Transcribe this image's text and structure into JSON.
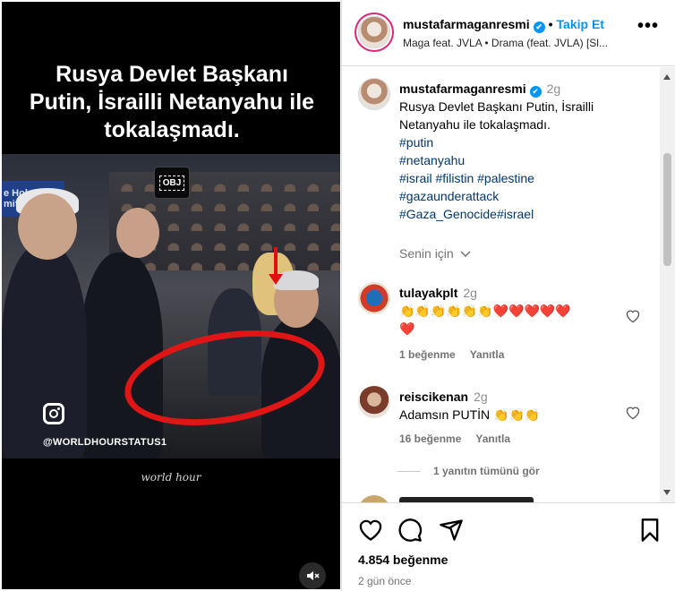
{
  "video": {
    "headline_lines": [
      "Rusya Devlet Başkanı",
      "Putin, İsrailli Netanyahu ile",
      "tokalaşmadı."
    ],
    "obj_badge": "OBJ",
    "screen_text": "e Holo\nmitism",
    "watermark_handle": "@WORLDHOURSTATUS1",
    "footer_watermark": "world hour",
    "mute_icon": "speaker-muted-icon",
    "annotation_color": "#e01515"
  },
  "header": {
    "username": "mustafarmaganresmi",
    "verified": "✔",
    "separator": "•",
    "follow_label": "Takip Et",
    "subtitle": "Maga feat. JVLA • Drama (feat. JVLA) [Sl...",
    "more_label": "•••"
  },
  "caption": {
    "username": "mustafarmaganresmi",
    "time": "2g",
    "text": "Rusya Devlet Başkanı Putin, İsrailli Netanyahu ile tokalaşmadı.",
    "hashtags": [
      "#putin",
      "#netanyahu",
      "#israil #filistin #palestine",
      "#gazaunderattack",
      "#Gaza_Genocide#israel"
    ]
  },
  "sort_label": "Senin için",
  "comments": [
    {
      "username": "tulayakplt",
      "time": "2g",
      "text_line1": "👏👏👏👏👏👏",
      "hearts_line1": "❤️❤️❤️❤️❤️",
      "hearts_line2": "❤️",
      "likes": "1 beğenme",
      "reply": "Yanıtla"
    },
    {
      "username": "reiscikenan",
      "time": "2g",
      "text": "Adamsın PUTİN 👏👏👏",
      "likes": "16 beğenme",
      "reply": "Yanıtla"
    }
  ],
  "view_replies": "1 yanıtın tümünü gör",
  "footer": {
    "likes": "4.854 beğenme",
    "ago": "2 gün önce"
  },
  "colors": {
    "link": "#0095f6",
    "hashtag": "#00376b",
    "muted": "#737373"
  }
}
